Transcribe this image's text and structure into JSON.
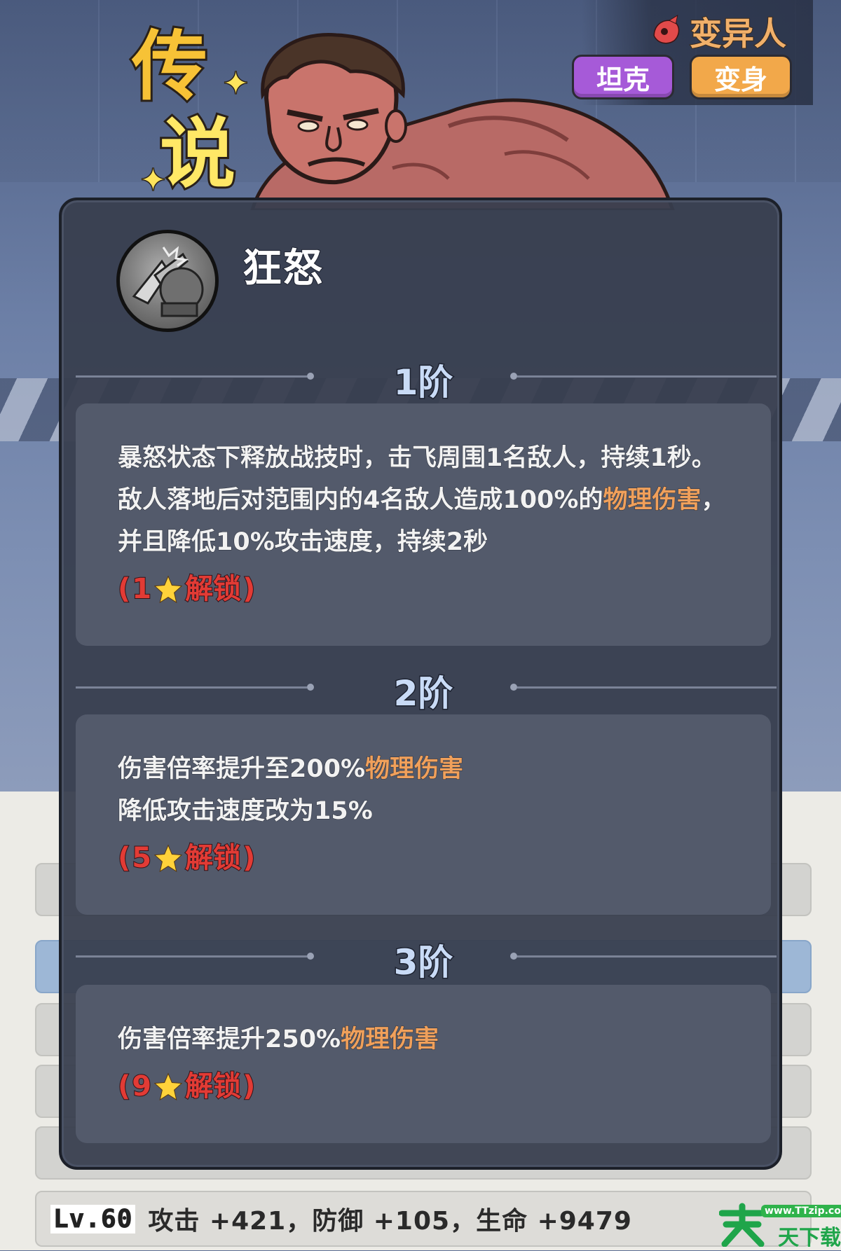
{
  "header": {
    "rarity_line1": "传",
    "rarity_line2": "说",
    "race_label": "变异人",
    "race_icon": "mutant-icon",
    "tags": [
      "坦克",
      "变身"
    ],
    "tag_colors": [
      "#a65ad8",
      "#f2a84a"
    ]
  },
  "skill": {
    "icon": "rage-skill-icon",
    "name": "狂怒",
    "tiers": [
      {
        "label": "1阶",
        "text_before": "暴怒状态下释放战技时，击飞周围1名敌人，持续1秒。敌人落地后对范围内的4名敌人造成100%的",
        "highlight": "物理伤害",
        "text_after": "，并且降低10%攻击速度，持续2秒",
        "unlock_open": "(",
        "unlock_stars": "1",
        "unlock_text": "解锁",
        "unlock_close": ")"
      },
      {
        "label": "2阶",
        "line1_before": "伤害倍率提升至200%",
        "highlight": "物理伤害",
        "line2": "降低攻击速度改为15%",
        "unlock_open": "(",
        "unlock_stars": "5",
        "unlock_text": "解锁",
        "unlock_close": ")"
      },
      {
        "label": "3阶",
        "line1_before": "伤害倍率提升250%",
        "highlight": "物理伤害",
        "unlock_open": "(",
        "unlock_stars": "9",
        "unlock_text": "解锁",
        "unlock_close": ")"
      }
    ]
  },
  "level_rows": {
    "bottom_row": {
      "level": "Lv.60",
      "stats": "攻击 +421，防御 +105，生命 +9479"
    }
  },
  "watermark": {
    "url": "www.TTzip.com",
    "text": "天下载"
  },
  "colors": {
    "highlight": "#f0a05b",
    "unlock": "#e23b35",
    "tier_label": "#c9dbf6",
    "panel": "#373e4e"
  }
}
